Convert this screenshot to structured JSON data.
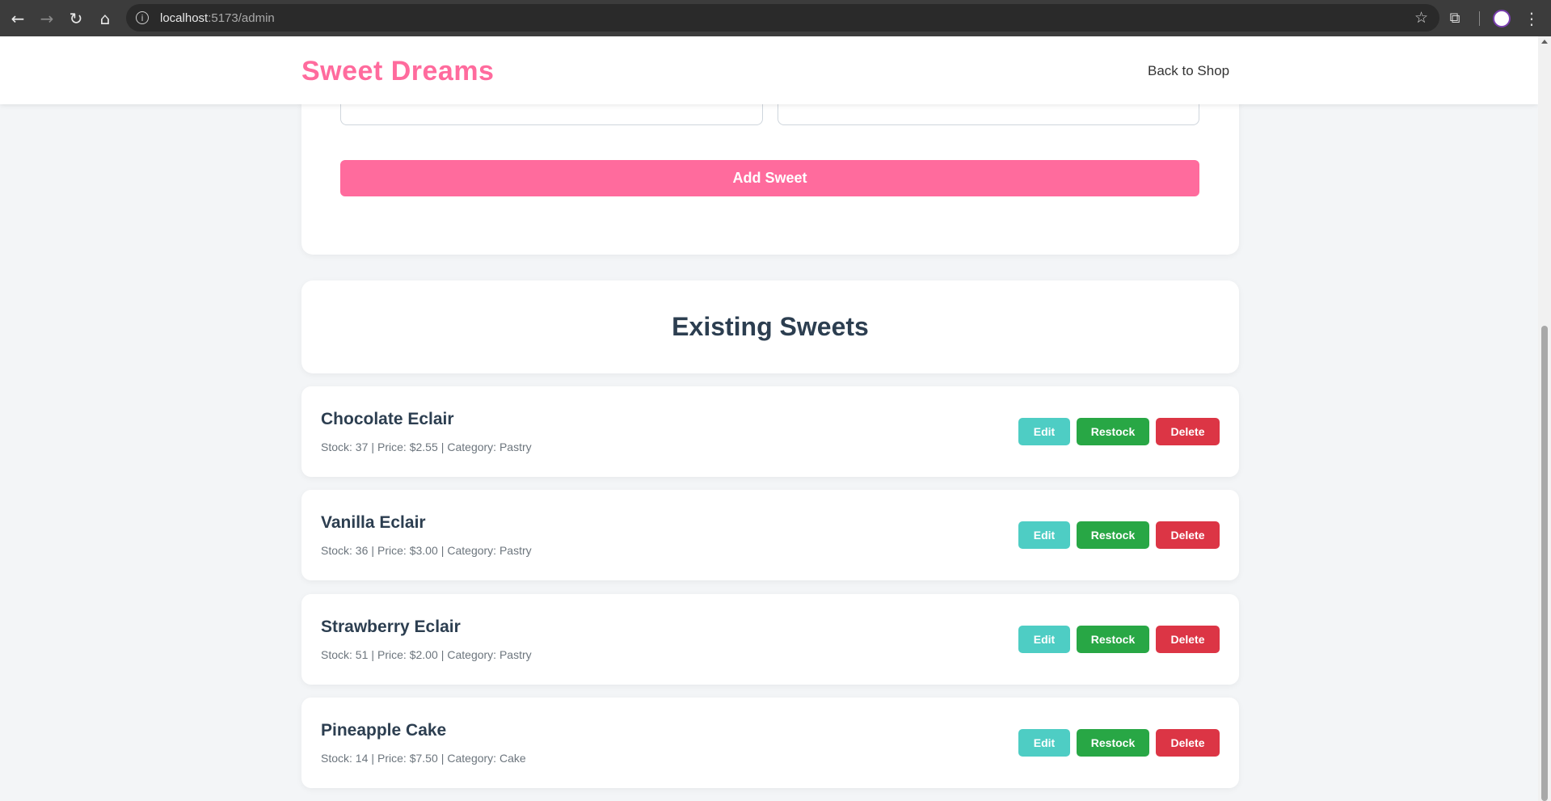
{
  "browser": {
    "url_host": "localhost",
    "url_path": ":5173/admin"
  },
  "header": {
    "logo": "Sweet Dreams",
    "back_link": "Back to Shop"
  },
  "form": {
    "submit_label": "Add Sweet"
  },
  "list": {
    "heading": "Existing Sweets",
    "items": [
      {
        "name": "Chocolate Eclair",
        "stock": "Stock: 37",
        "price": "Price: $2.55",
        "category": "Category: Pastry"
      },
      {
        "name": "Vanilla Eclair",
        "stock": "Stock: 36",
        "price": "Price: $3.00",
        "category": "Category: Pastry"
      },
      {
        "name": "Strawberry Eclair",
        "stock": "Stock: 51",
        "price": "Price: $2.00",
        "category": "Category: Pastry"
      },
      {
        "name": "Pineapple Cake",
        "stock": "Stock: 14",
        "price": "Price: $7.50",
        "category": "Category: Cake"
      }
    ],
    "edit_label": "Edit",
    "restock_label": "Restock",
    "delete_label": "Delete"
  },
  "colors": {
    "brand": "#ff6b9d",
    "edit": "#4ecdc4",
    "restock": "#28a745",
    "delete": "#dc3545"
  }
}
